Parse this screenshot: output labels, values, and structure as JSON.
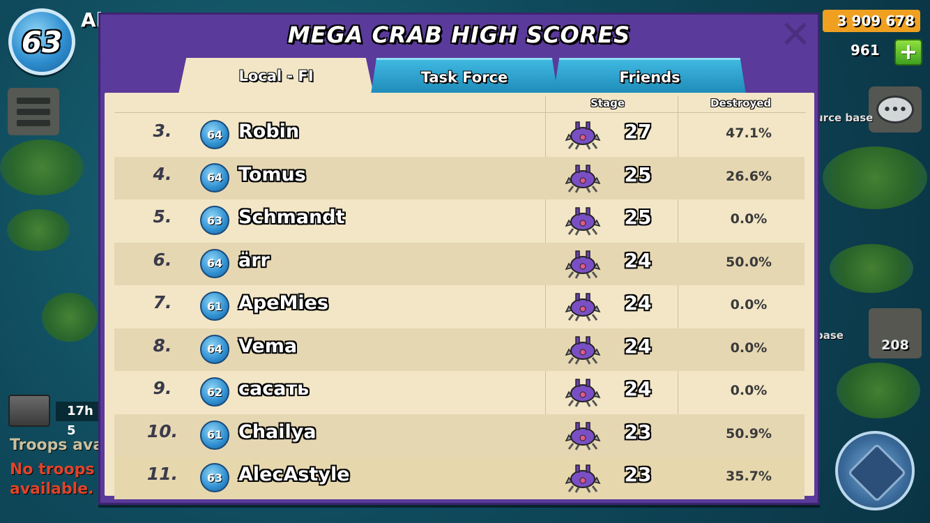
{
  "hud": {
    "player_level": "63",
    "player_name_partial": "Al",
    "gold": "3 909 678",
    "diamonds": "961",
    "plus_label": "+",
    "chat_label": "•••",
    "side_label_1": "urce base",
    "side_label_2": "base",
    "troops_count": "208",
    "chest_timer": "17h 5",
    "troops_available": "Troops avai",
    "no_troops": "No troops available."
  },
  "dialog": {
    "title": "MEGA CRAB HIGH SCORES",
    "close_label": "✕",
    "tabs": [
      {
        "label": "Local - FI",
        "active": true
      },
      {
        "label": "Task Force",
        "active": false
      },
      {
        "label": "Friends",
        "active": false
      }
    ],
    "columns": {
      "stage": "Stage",
      "destroyed": "Destroyed"
    },
    "rows": [
      {
        "rank": "3.",
        "level": "64",
        "name": "Robin",
        "stage": "27",
        "destroyed": "47.1%"
      },
      {
        "rank": "4.",
        "level": "64",
        "name": "Tomus",
        "stage": "25",
        "destroyed": "26.6%"
      },
      {
        "rank": "5.",
        "level": "63",
        "name": "Schmandt",
        "stage": "25",
        "destroyed": "0.0%"
      },
      {
        "rank": "6.",
        "level": "64",
        "name": "ärr",
        "stage": "24",
        "destroyed": "50.0%"
      },
      {
        "rank": "7.",
        "level": "61",
        "name": "ApeMies",
        "stage": "24",
        "destroyed": "0.0%"
      },
      {
        "rank": "8.",
        "level": "64",
        "name": "Vema",
        "stage": "24",
        "destroyed": "0.0%"
      },
      {
        "rank": "9.",
        "level": "62",
        "name": "сасать",
        "stage": "24",
        "destroyed": "0.0%"
      },
      {
        "rank": "10.",
        "level": "61",
        "name": "Chailya",
        "stage": "23",
        "destroyed": "50.9%"
      },
      {
        "rank": "11.",
        "level": "63",
        "name": "AlecAstyle",
        "stage": "23",
        "destroyed": "35.7%"
      }
    ]
  }
}
